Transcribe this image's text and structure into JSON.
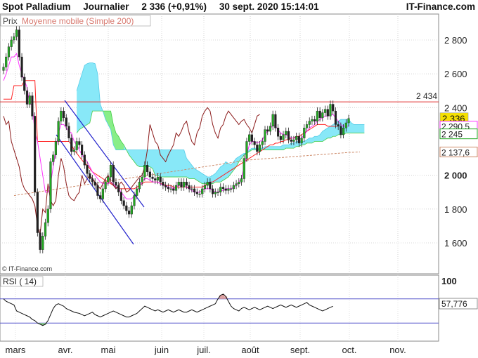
{
  "header": {
    "instrument": "Spot Palladium",
    "period": "Journalier",
    "last_price": "2 336",
    "change": "(+0,91%)",
    "datetime": "30 sept. 2020 15:14:01",
    "brand": "IT-Finance.com"
  },
  "legend": {
    "price_label": "Prix",
    "ma_label": "Moyenne mobile (Simple 200)"
  },
  "watermark": "© IT-Finance.com",
  "rsi_panel": {
    "label": "RSI ( 14)",
    "upper_tick": "100",
    "value_label": "57,776"
  },
  "colors": {
    "bull": "#22aa22",
    "bear": "#222222",
    "cloud_bull": "#88e8f8",
    "cloud_bear": "#88ee88",
    "ma200": "#cc8866",
    "resistance": "#e03030",
    "channel": "#2222cc",
    "kijun": "#ff2222",
    "tenkan": "#ff33ff",
    "chikou": "#8b1a1a",
    "rsi": "#111111",
    "rsi_band": "#5555cc"
  },
  "chart_data": [
    {
      "type": "candlestick",
      "title": "Spot Palladium",
      "y_ticks": [
        "2 800",
        "2 600",
        "2 400",
        "2 000",
        "1 800",
        "1 600"
      ],
      "ylim": [
        1500,
        2920
      ],
      "x_ticks": [
        "mars",
        "avr.",
        "mai",
        "juin",
        "juil.",
        "août",
        "sept.",
        "oct.",
        "nov."
      ],
      "price_tags": [
        {
          "text": "2 434",
          "value": 2434,
          "color": "#e03030",
          "style": "plain"
        },
        {
          "text": "2 336",
          "value": 2336,
          "color": "#f5e000",
          "style": "yellow"
        },
        {
          "text": "2 290,5",
          "value": 2290.5,
          "color": "#ff33ff",
          "style": "outline"
        },
        {
          "text": "2 245",
          "value": 2245,
          "color": "#22aa22",
          "style": "outline"
        },
        {
          "text": "2 137,6",
          "value": 2137.6,
          "color": "#cc8866",
          "style": "outline"
        }
      ],
      "resistance_level": 2434,
      "closes": [
        2640,
        2700,
        2760,
        2800,
        2820,
        2860,
        2700,
        2580,
        2500,
        2420,
        2470,
        2350,
        1900,
        1660,
        1560,
        1640,
        1720,
        1800,
        2080,
        2120,
        2200,
        2320,
        2380,
        2340,
        2290,
        2220,
        2140,
        2150,
        2200,
        2180,
        2120,
        2060,
        2010,
        1980,
        1960,
        1940,
        1880,
        1860,
        1920,
        1960,
        1990,
        2060,
        1960,
        1940,
        1900,
        1850,
        1820,
        1790,
        1770,
        1820,
        1880,
        1920,
        1960,
        1990,
        2060,
        2020,
        1990,
        1980,
        1970,
        1990,
        1960,
        1940,
        1930,
        1920,
        1920,
        1910,
        1940,
        1960,
        1930,
        1960,
        1940,
        1920,
        1920,
        1900,
        1890,
        1890,
        1920,
        1940,
        1960,
        1920,
        1890,
        1900,
        1900,
        1930,
        1920,
        1910,
        1920,
        1920,
        1940,
        1950,
        1960,
        1980,
        2100,
        2200,
        2240,
        2200,
        2180,
        2140,
        2180,
        2200,
        2270,
        2260,
        2290,
        2360,
        2280,
        2230,
        2210,
        2240,
        2260,
        2210,
        2200,
        2210,
        2230,
        2190,
        2220,
        2280,
        2300,
        2320,
        2330,
        2320,
        2380,
        2340,
        2370,
        2390,
        2350,
        2420,
        2380,
        2300,
        2290,
        2240,
        2280,
        2310,
        2336
      ],
      "ichimoku_cloud": {
        "x_start_index": 28,
        "span_a": [
          2500,
          2550,
          2600,
          2650,
          2660,
          2665,
          2665,
          2660,
          2600,
          2420,
          2380,
          2330,
          2300,
          2270,
          2180,
          2150,
          2150,
          2150,
          2150,
          2150,
          2150,
          2150,
          2150,
          2150,
          2150,
          2150,
          2150,
          2150,
          2150,
          2150,
          2150,
          2150,
          2150,
          2150,
          2150,
          2150,
          2150,
          2150,
          2150,
          2150,
          2150,
          2150,
          2100,
          2080,
          2060,
          2040,
          2030,
          2020,
          2010,
          2000,
          1990,
          1990,
          2000,
          2010,
          2030,
          2050,
          2060,
          2080,
          2070,
          2060,
          2080,
          2100,
          2110,
          2120,
          2130,
          2130,
          2150,
          2160,
          2160,
          2160,
          2160,
          2160,
          2170,
          2170,
          2170,
          2170,
          2170,
          2170,
          2170,
          2180,
          2180,
          2180,
          2190,
          2190,
          2200,
          2200,
          2200,
          2200,
          2210,
          2220,
          2220,
          2230,
          2230,
          2240,
          2260,
          2270,
          2280,
          2290,
          2300,
          2310,
          2320,
          2330,
          2330,
          2330,
          2330,
          2310,
          2300,
          2300,
          2300,
          2300,
          2300
        ],
        "span_b": [
          2250,
          2270,
          2280,
          2290,
          2300,
          2310,
          2380,
          2380,
          2380,
          2380,
          2380,
          2380,
          2380,
          2380,
          2300,
          2250,
          2230,
          2200,
          2180,
          2150,
          2120,
          2100,
          2080,
          2060,
          2050,
          2050,
          2050,
          2050,
          2050,
          2040,
          2000,
          2000,
          1990,
          1990,
          1990,
          1990,
          1990,
          1990,
          1990,
          1990,
          1990,
          1990,
          1990,
          1980,
          1980,
          1980,
          1970,
          1960,
          1950,
          1950,
          1950,
          1950,
          1950,
          1960,
          1960,
          1960,
          1970,
          1980,
          1990,
          2010,
          2030,
          2050,
          2080,
          2100,
          2120,
          2130,
          2140,
          2150,
          2150,
          2150,
          2150,
          2150,
          2150,
          2150,
          2150,
          2150,
          2150,
          2150,
          2150,
          2150,
          2160,
          2160,
          2160,
          2160,
          2170,
          2170,
          2180,
          2180,
          2190,
          2190,
          2190,
          2200,
          2200,
          2200,
          2200,
          2210,
          2220,
          2220,
          2230,
          2230,
          2240,
          2240,
          2240,
          2250,
          2250,
          2250,
          2250,
          2250,
          2250,
          2250,
          2250
        ]
      },
      "lines": [
        {
          "name": "",
          "kind": "ma200",
          "x_start_index": 0,
          "values": [
            1880,
            1890,
            1900,
            1910,
            1920,
            1930,
            1940,
            1950,
            1960,
            1970,
            1980,
            1990,
            2000,
            2010,
            2020,
            2030,
            2040,
            2050,
            2060,
            2070,
            2080,
            2090,
            2095,
            2100,
            2105,
            2110,
            2115,
            2120,
            2125,
            2130,
            2135,
            2137.6
          ]
        },
        {
          "name": "",
          "kind": "kijun",
          "x_start_index": 0,
          "values": [
            2450,
            2450,
            2450,
            2450,
            2530,
            2530,
            2530,
            2530,
            2560,
            2560,
            2560,
            2560,
            2560,
            2200,
            2200,
            2200,
            2200,
            2200,
            2200,
            2200,
            2200,
            2200,
            2200,
            2200,
            2200,
            2200,
            2180,
            2150,
            2130,
            2110,
            2090,
            2070,
            2060,
            2040,
            2020,
            2010,
            2000,
            1990,
            1980,
            1970,
            1960,
            1950,
            1940,
            1930,
            1920,
            1920,
            1920,
            1920,
            1920,
            1920,
            1920,
            1930,
            1940,
            1950,
            1960,
            1960,
            1960,
            1960,
            1960,
            1960,
            1950,
            1950,
            1940,
            1940,
            1940,
            1930,
            1930,
            1930,
            1930,
            1930,
            1930,
            1930,
            1930,
            1930,
            1930,
            1930,
            1930,
            1940,
            1950,
            1960,
            1960,
            1970,
            1980,
            1990,
            2000,
            2010,
            2020,
            2030,
            2040,
            2050,
            2060,
            2070,
            2080,
            2090,
            2100,
            2110,
            2120,
            2130,
            2140,
            2150,
            2160,
            2170,
            2180,
            2180,
            2190,
            2190,
            2200,
            2200,
            2210,
            2210,
            2220,
            2220,
            2230,
            2230,
            2240,
            2250,
            2260,
            2270,
            2280,
            2290,
            2300,
            2300,
            2300,
            2300,
            2290,
            2290,
            2290,
            2290,
            2290.5
          ]
        },
        {
          "name": "",
          "kind": "tenkan",
          "x_start_index": 0,
          "values": [
            2560,
            2600,
            2650,
            2700,
            2700,
            2720,
            2650,
            2600,
            2560,
            2520,
            2420,
            2420,
            2250,
            2200,
            2100,
            2000,
            1900,
            1900,
            1950,
            2050,
            2150,
            2250,
            2300,
            2300,
            2280,
            2260,
            2250,
            2200,
            2180,
            2150,
            2120,
            2100,
            2080,
            2050,
            2020,
            2000,
            1980,
            1960,
            1950,
            1950,
            1950,
            1960,
            1950,
            1930,
            1920,
            1900,
            1880,
            1860,
            1860,
            1860,
            1880,
            1900,
            1930,
            1960,
            1980,
            1980,
            1970,
            1960,
            1960,
            1960,
            1950,
            1940,
            1940,
            1930,
            1930,
            1920,
            1930,
            1940,
            1940,
            1940,
            1930,
            1920,
            1910,
            1900,
            1900,
            1900,
            1910,
            1920,
            1920,
            1920,
            1910,
            1900,
            1900,
            1910,
            1910,
            1920,
            1920,
            1920,
            1930,
            1940,
            1960,
            1980,
            2050,
            2120,
            2180,
            2200,
            2200,
            2190,
            2200,
            2210,
            2240,
            2260,
            2270,
            2300,
            2290,
            2270,
            2250,
            2240,
            2240,
            2230,
            2220,
            2220,
            2220,
            2210,
            2220,
            2240,
            2260,
            2280,
            2290,
            2300,
            2320,
            2330,
            2340,
            2350,
            2350,
            2360,
            2360,
            2340,
            2320,
            2300,
            2290,
            2290,
            2290.5
          ]
        },
        {
          "name": "",
          "kind": "chikou",
          "x_start_index": 0,
          "values": [
            2350,
            2300,
            2320,
            2200,
            2150,
            2100,
            2050,
            1960,
            1920,
            1900,
            1880,
            1860,
            1820,
            1700,
            1650,
            1800,
            1780,
            1950,
            1850,
            1820,
            1850,
            2000,
            2100,
            2050,
            1950,
            1880,
            1860,
            1850,
            1880,
            1900,
            2000,
            1950,
            1980,
            2000,
            1980,
            1960,
            1940,
            1920,
            1950,
            1980,
            2000,
            1960,
            1940,
            1920,
            1940,
            1960,
            1940,
            1900,
            1910,
            1930,
            1950,
            1970,
            1990,
            2000,
            2050,
            2150,
            2300,
            2250,
            2200,
            2180,
            2120,
            2100,
            2080,
            2120,
            2150,
            2180,
            2250,
            2230,
            2260,
            2300,
            2320,
            2250,
            2200,
            2180,
            2250,
            2280,
            2350,
            2380,
            2400,
            2380,
            2300,
            2250,
            2220,
            2280,
            2300,
            2350,
            2380,
            2360,
            2340,
            2320,
            2300,
            2320,
            2330,
            2300,
            2280,
            2250,
            2300,
            2350,
            2360
          ]
        }
      ]
    },
    {
      "type": "line",
      "title": "RSI ( 14)",
      "y_ticks": [
        "100"
      ],
      "ylim": [
        0,
        100
      ],
      "bands": [
        70,
        30
      ],
      "values": [
        70,
        66,
        64,
        62,
        60,
        50,
        48,
        46,
        44,
        42,
        40,
        36,
        34,
        30,
        28,
        26,
        28,
        34,
        44,
        54,
        60,
        62,
        60,
        58,
        54,
        52,
        50,
        48,
        47,
        46,
        44,
        42,
        44,
        46,
        48,
        44,
        42,
        40,
        42,
        44,
        46,
        48,
        50,
        48,
        46,
        44,
        42,
        40,
        40,
        42,
        44,
        46,
        50,
        54,
        58,
        56,
        54,
        52,
        50,
        52,
        50,
        48,
        50,
        52,
        50,
        48,
        50,
        52,
        50,
        48,
        48,
        50,
        52,
        50,
        48,
        50,
        52,
        54,
        56,
        58,
        60,
        62,
        70,
        76,
        78,
        74,
        66,
        58,
        54,
        52,
        50,
        54,
        56,
        54,
        52,
        54,
        56,
        54,
        52,
        54,
        56,
        58,
        56,
        54,
        56,
        58,
        60,
        58,
        56,
        58,
        60,
        58,
        56,
        58,
        60,
        62,
        64,
        60,
        58,
        56,
        54,
        52,
        50,
        52,
        54,
        56,
        57.776
      ]
    }
  ]
}
